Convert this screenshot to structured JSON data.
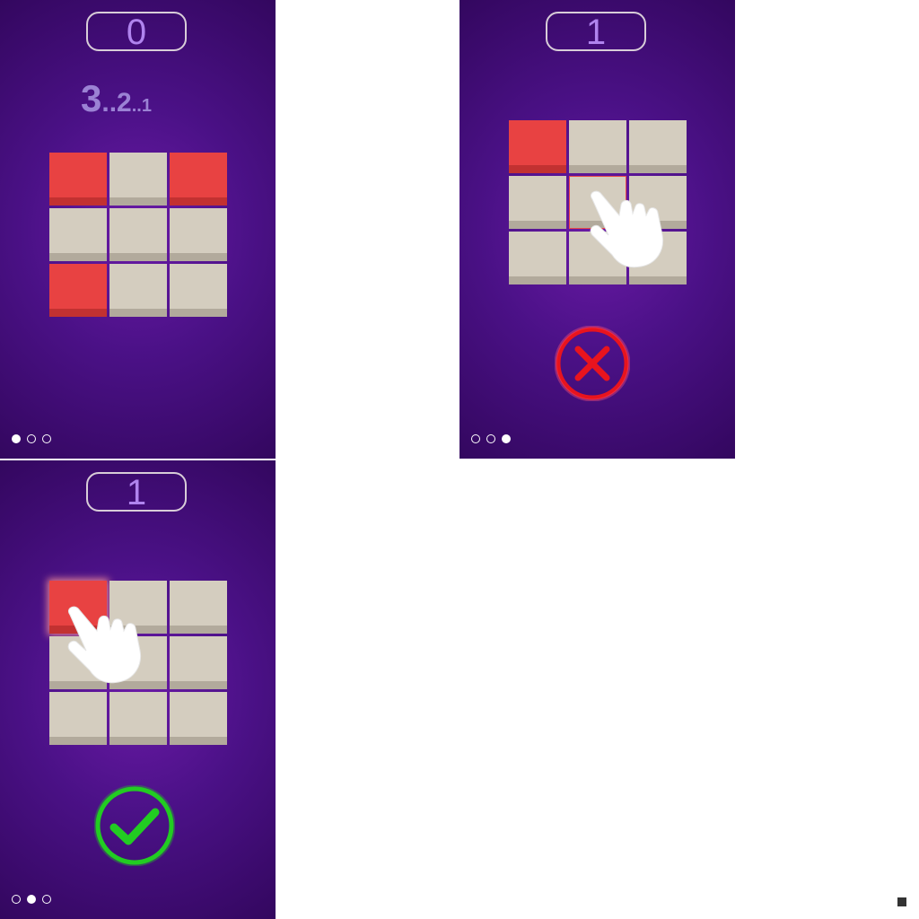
{
  "screens": [
    {
      "score": "0",
      "countdown": {
        "n3": "3",
        "sep1": "..",
        "n2": "2",
        "sep2": "..",
        "n1": "1"
      },
      "tiles": [
        "red",
        "beige",
        "red",
        "beige",
        "beige",
        "beige",
        "red",
        "beige",
        "beige"
      ],
      "page_indicator": {
        "total": 3,
        "active": 0
      }
    },
    {
      "score": "1",
      "tiles": [
        "red",
        "beige",
        "beige",
        "beige",
        "beige",
        "beige",
        "beige",
        "beige",
        "beige"
      ],
      "feedback": "check-icon",
      "page_indicator": {
        "total": 3,
        "active": 1
      }
    },
    {
      "score": "1",
      "tiles": [
        "red",
        "beige",
        "beige",
        "beige",
        "beige",
        "beige",
        "beige",
        "beige",
        "beige"
      ],
      "feedback": "cross-icon",
      "page_indicator": {
        "total": 3,
        "active": 2
      }
    }
  ],
  "colors": {
    "background_top": "#33075f",
    "background_center": "#6a1aa6",
    "tile_red": "#e84242",
    "tile_beige": "#d4cdbf",
    "score_text": "#b084ee",
    "success": "#22cc22",
    "error": "#e8141e"
  },
  "icons": [
    "pointing-hand-icon",
    "check-icon",
    "cross-icon"
  ]
}
